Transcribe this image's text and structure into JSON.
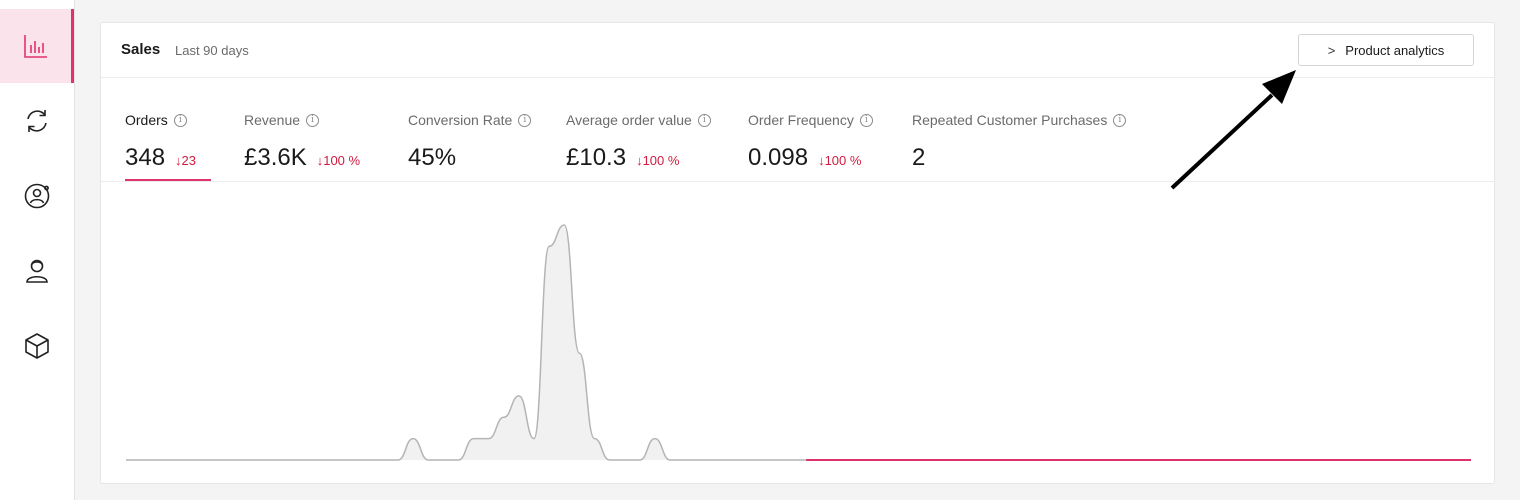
{
  "sidebar": {
    "items": [
      {
        "icon": "bar-chart-icon",
        "active": true
      },
      {
        "icon": "refresh-icon",
        "active": false
      },
      {
        "icon": "customer-circle-icon",
        "active": false
      },
      {
        "icon": "user-icon",
        "active": false
      },
      {
        "icon": "box-icon",
        "active": false
      }
    ]
  },
  "card": {
    "title": "Sales",
    "subtitle": "Last 90 days",
    "button_label": "Product analytics",
    "button_icon": "chevron-right-icon"
  },
  "metrics": [
    {
      "label": "Orders",
      "value": "348",
      "change": "↓23",
      "active": true
    },
    {
      "label": "Revenue",
      "value": "£3.6K",
      "change": "↓100 %",
      "active": false
    },
    {
      "label": "Conversion Rate",
      "value": "45%",
      "change": "",
      "active": false
    },
    {
      "label": "Average order value",
      "value": "£10.3",
      "change": "↓100 %",
      "active": false
    },
    {
      "label": "Order Frequency",
      "value": "0.098",
      "change": "↓100 %",
      "active": false
    },
    {
      "label": "Repeated Customer Purchases",
      "value": "2",
      "change": "",
      "active": false
    }
  ],
  "colors": {
    "accent": "#e0336e",
    "accent_fill": "#f9d8e6",
    "previous_line": "#b4b4b4",
    "previous_fill": "#f1f1f1",
    "negative": "#d21b3e"
  },
  "chart_data": {
    "type": "area",
    "series": [
      {
        "values": [
          0,
          0,
          0,
          0,
          0,
          0,
          0,
          0,
          0,
          0,
          0,
          0,
          0,
          0,
          0,
          0,
          0,
          0,
          0,
          1,
          0,
          0,
          0,
          1,
          1,
          2,
          3,
          1,
          10,
          11,
          5,
          1,
          0,
          0,
          0,
          1,
          0,
          0,
          0,
          0,
          0,
          0,
          0,
          0,
          0,
          0,
          0,
          0,
          0,
          0,
          0,
          0,
          0,
          0,
          0,
          0,
          0,
          0,
          0,
          0,
          0,
          0,
          0,
          0,
          0,
          0,
          0,
          0,
          0,
          0,
          0,
          0,
          0,
          0,
          0,
          0,
          0,
          0,
          0,
          0,
          0,
          0,
          0,
          0,
          0,
          0,
          0,
          0,
          0,
          0
        ]
      }
    ]
  }
}
